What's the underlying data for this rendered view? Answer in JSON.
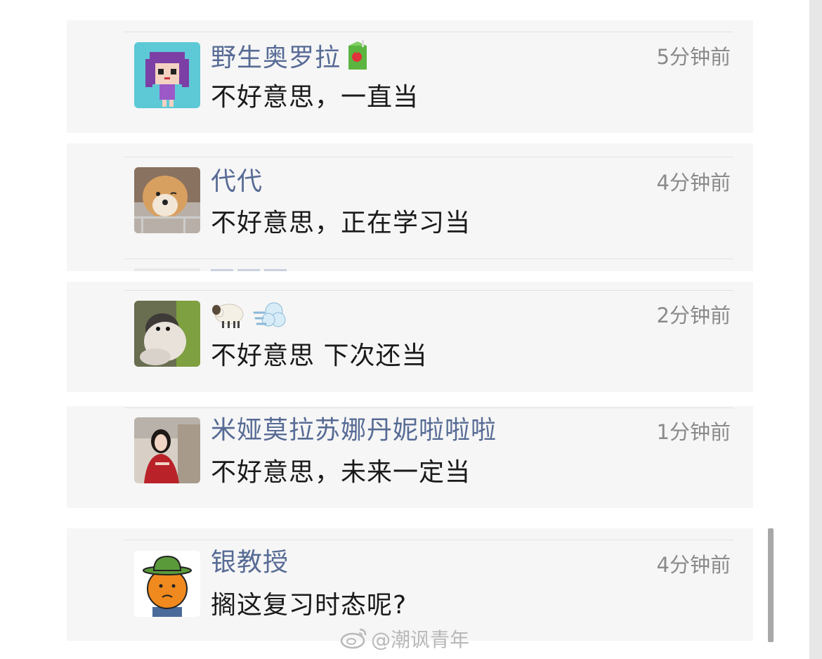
{
  "comments": [
    {
      "name": "野生奥罗拉",
      "name_emoji": "juice-box-emoji",
      "time": "5分钟前",
      "text": "不好意思，一直当",
      "avatar": "pixel-girl-avatar"
    },
    {
      "name": "代代",
      "time": "4分钟前",
      "text": "不好意思，正在学习当",
      "avatar": "dog-photo-avatar"
    },
    {
      "name": "",
      "name_emoji": "sheep-emoji, dash-emoji",
      "time": "2分钟前",
      "text": "不好意思 下次还当",
      "avatar": "cat-photo-avatar"
    },
    {
      "name": "米娅莫拉苏娜丹妮啦啦啦",
      "time": "1分钟前",
      "text": "不好意思，未来一定当",
      "avatar": "woman-photo-avatar"
    },
    {
      "name": "银教授",
      "time": "4分钟前",
      "text": "搁这复习时态呢?",
      "avatar": "orange-cowboy-avatar"
    }
  ],
  "watermark": "@潮讽青年",
  "colors": {
    "name": "#576b95",
    "text": "#1a1a1a",
    "time": "#8a8a8a",
    "card": "#f6f6f6"
  }
}
